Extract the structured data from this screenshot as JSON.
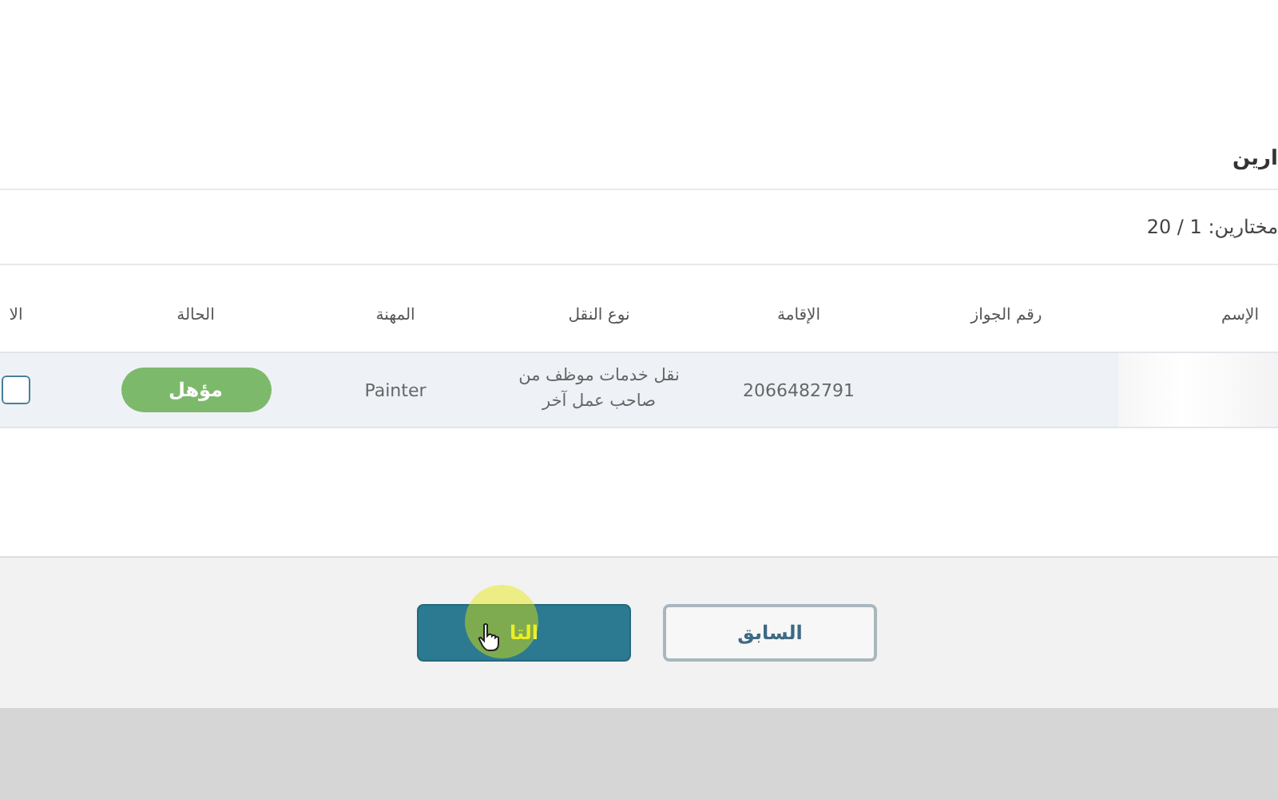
{
  "section_title": "ارين",
  "selection_count": "مختارين: 1 / 20",
  "table": {
    "columns": [
      "الإسم",
      "رقم الجواز",
      "الإقامة",
      "نوع النقل",
      "المهنة",
      "الحالة",
      "الا"
    ],
    "rows": [
      {
        "iqama": "2066482791",
        "transfer_type": "نقل خدمات موظف من صاحب عمل آخر",
        "job": "Painter",
        "status": "مؤهل"
      }
    ]
  },
  "buttons": [
    {
      "label": "السابق",
      "kind": "secondary"
    },
    {
      "label": "التا",
      "kind": "primary"
    }
  ]
}
